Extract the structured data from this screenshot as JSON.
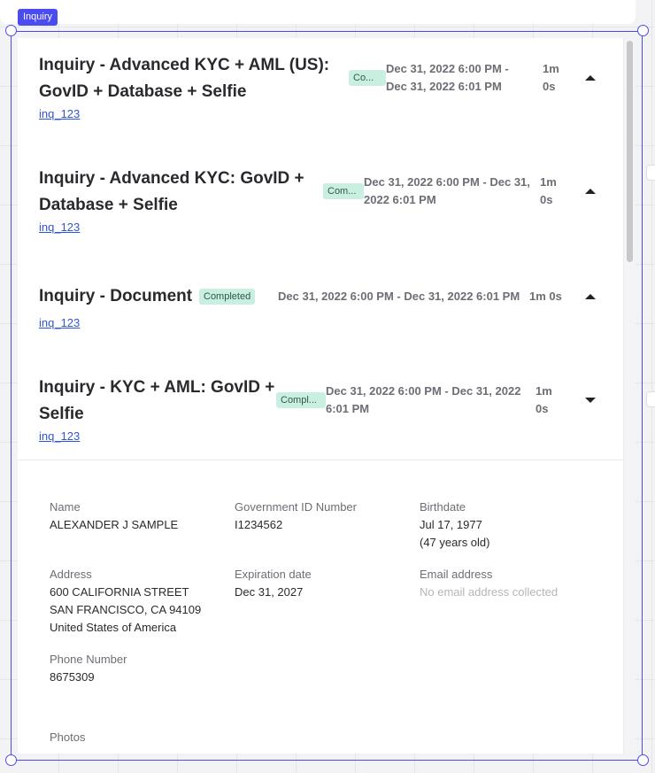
{
  "tag": "Inquiry",
  "inquiries": [
    {
      "title_line1": "Inquiry - Advanced KYC + AML (US):",
      "title_line2": "GovID + Database + Selfie",
      "status": "Co...",
      "date_line1": "Dec 31, 2022 6:00 PM -",
      "date_line2": "Dec 31, 2022 6:01 PM",
      "duration_line1": "1m",
      "duration_line2": "0s",
      "id": "inq_123"
    },
    {
      "title_line1": "Inquiry - Advanced KYC: GovID +",
      "title_line2": "Database + Selfie",
      "status": "Com...",
      "date_line1": "Dec 31, 2022 6:00 PM - Dec 31,",
      "date_line2": "2022 6:01 PM",
      "duration_line1": "1m",
      "duration_line2": "0s",
      "id": "inq_123"
    },
    {
      "title_line1": "Inquiry - Document",
      "status": "Completed",
      "date_line1": "Dec 31, 2022 6:00 PM - Dec 31, 2022 6:01 PM",
      "duration_line1": "1m 0s",
      "id": "inq_123"
    },
    {
      "title_line1": "Inquiry - KYC + AML: GovID +",
      "title_line2": "Selfie",
      "status": "Compl...",
      "date_line1": "Dec 31, 2022 6:00 PM - Dec 31, 2022",
      "date_line2": "6:01 PM",
      "duration_line1": "1m",
      "duration_line2": "0s",
      "id": "inq_123"
    }
  ],
  "details": {
    "name_label": "Name",
    "name_value": "ALEXANDER J SAMPLE",
    "govid_label": "Government ID Number",
    "govid_value": "I1234562",
    "birthdate_label": "Birthdate",
    "birthdate_value": "Jul 17, 1977",
    "birthdate_age": "(47 years old)",
    "address_label": "Address",
    "address_line1": "600 CALIFORNIA STREET",
    "address_line2": "SAN FRANCISCO, CA 94109",
    "address_line3": "United States of America",
    "expiration_label": "Expiration date",
    "expiration_value": "Dec 31, 2027",
    "email_label": "Email address",
    "email_value": "No email address collected",
    "phone_label": "Phone Number",
    "phone_value": "8675309",
    "photos_label": "Photos"
  }
}
